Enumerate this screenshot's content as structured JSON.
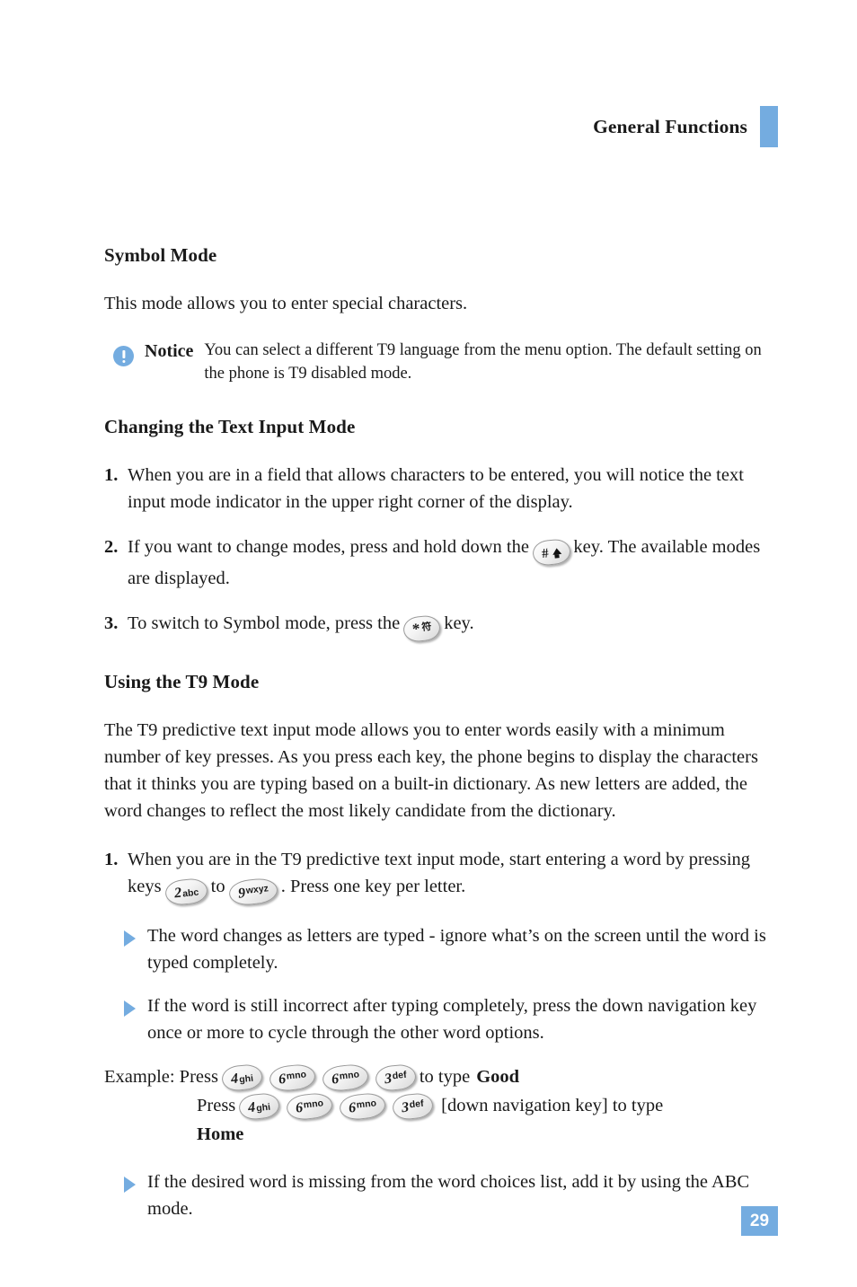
{
  "header": {
    "title": "General Functions",
    "marker_color": "#74ACE0"
  },
  "sections": {
    "symbol_mode": {
      "heading": "Symbol Mode",
      "paragraph": "This mode allows you to enter special characters."
    },
    "notice": {
      "icon": "info-exclamation-icon",
      "label": "Notice",
      "text": "You can select a different T9 language from the menu option. The default setting on the phone is T9 disabled mode."
    },
    "changing_mode": {
      "heading": "Changing the Text Input Mode",
      "steps": [
        {
          "number": "1.",
          "text": "When you are in a field that allows characters to be entered, you will notice the text input mode indicator in the upper right corner of the display."
        },
        {
          "number": "2.",
          "text_before": "If you want to change modes, press and hold down the",
          "key": {
            "digit": "#",
            "letters": "",
            "glyph": "shift-arrow"
          },
          "text_after": "key. The available modes are displayed."
        },
        {
          "number": "3.",
          "text_before": "To switch to Symbol mode, press the",
          "key": {
            "digit": "*",
            "letters": "",
            "glyph": "cjk-symbol"
          },
          "text_after": "key."
        }
      ]
    },
    "t9_mode": {
      "heading": "Using the T9 Mode",
      "paragraph": "The T9 predictive text input mode allows you to enter words easily with a minimum number of key presses. As you press each key, the phone begins to display the characters that it thinks you are typing based on a built-in dictionary. As new letters are added, the word changes to reflect the most likely candidate from the dictionary.",
      "step1": {
        "number": "1.",
        "text_before": "When you are in the T9 predictive text input mode, start entering a word by pressing keys",
        "key_from": {
          "digit": "2",
          "letters": "abc"
        },
        "text_middle": "to",
        "key_to": {
          "digit": "9",
          "letters": "wxyz"
        },
        "text_after": ". Press one key per letter."
      },
      "bullets": [
        "The word changes as letters are typed - ignore what’s on the screen until the word is typed completely.",
        "If the word is still incorrect after typing completely, press the down navigation key once or more to cycle through the other word options."
      ],
      "example": {
        "label": "Example: Press",
        "press_label": "Press",
        "keys_good": [
          {
            "digit": "4",
            "letters": "ghi"
          },
          {
            "digit": "6",
            "letters": "mno"
          },
          {
            "digit": "6",
            "letters": "mno"
          },
          {
            "digit": "3",
            "letters": "def"
          }
        ],
        "to_type_good": "to type",
        "word_good": "Good",
        "keys_home": [
          {
            "digit": "4",
            "letters": "ghi"
          },
          {
            "digit": "6",
            "letters": "mno"
          },
          {
            "digit": "6",
            "letters": "mno"
          },
          {
            "digit": "3",
            "letters": "def"
          }
        ],
        "down_nav_text": "[down navigation key] to type",
        "word_home": "Home"
      },
      "final_bullet": "If the desired word is missing from the word choices list, add it by using the ABC mode."
    }
  },
  "footer": {
    "page_number": "29",
    "badge_color": "#74ACE0"
  }
}
